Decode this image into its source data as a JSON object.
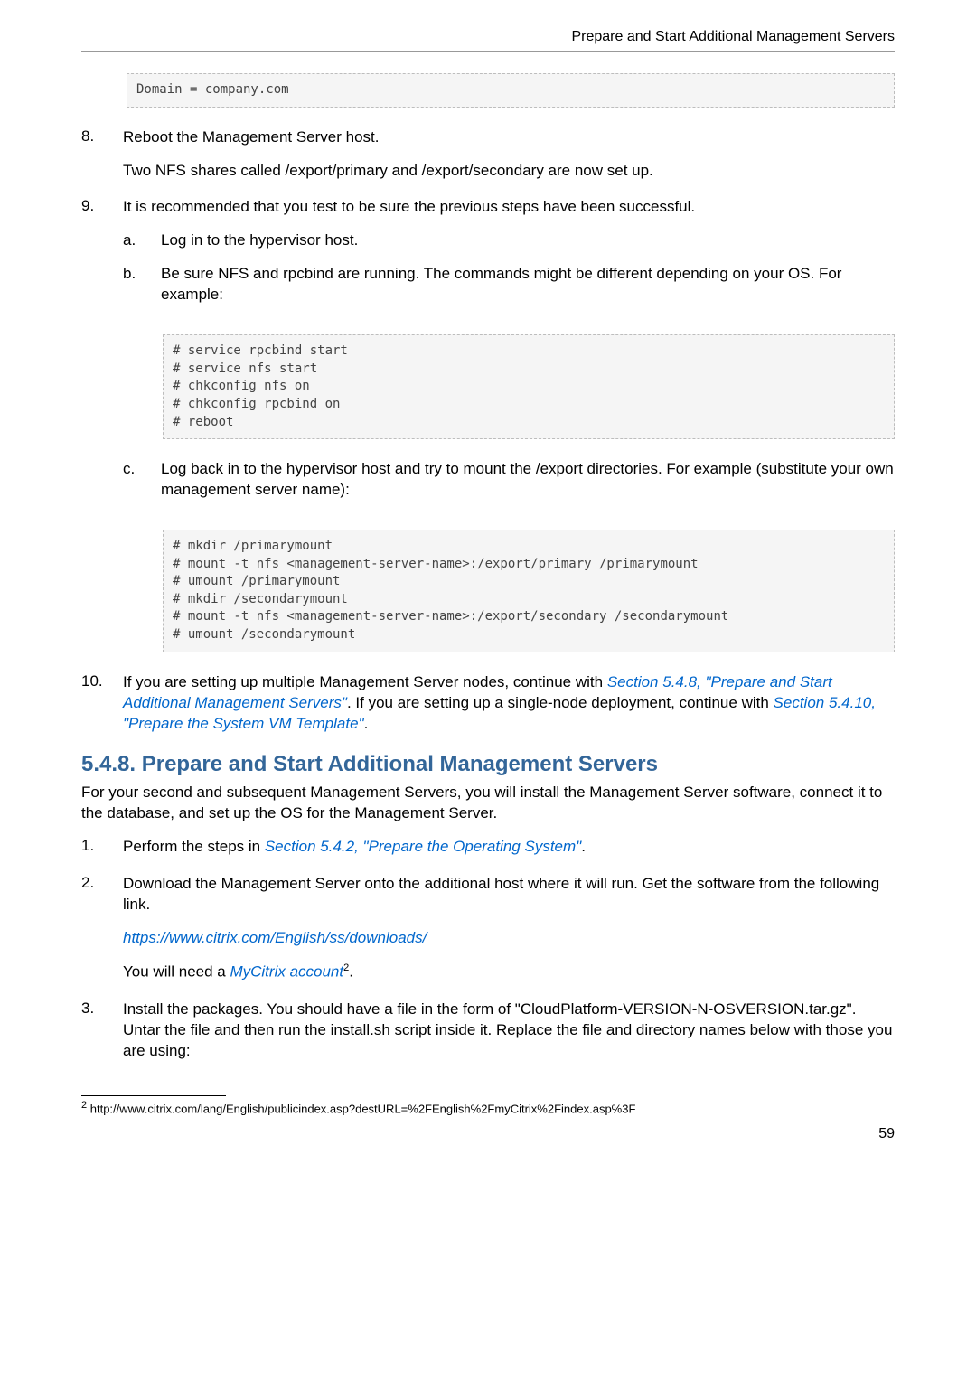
{
  "running_head": "Prepare and Start Additional Management Servers",
  "code_domain": "Domain = company.com",
  "step8": {
    "num": "8.",
    "p1": "Reboot the Management Server host.",
    "p2": "Two NFS shares called /export/primary and /export/secondary are now set up."
  },
  "step9": {
    "num": "9.",
    "p1": "It is recommended that you test to be sure the previous steps have been successful.",
    "a_num": "a.",
    "a": "Log in to the hypervisor host.",
    "b_num": "b.",
    "b": "Be sure NFS and rpcbind are running. The commands might be different depending on your OS. For example:",
    "code_b": "# service rpcbind start\n# service nfs start\n# chkconfig nfs on\n# chkconfig rpcbind on\n# reboot",
    "c_num": "c.",
    "c": "Log back in to the hypervisor host and try to mount the /export directories. For example (substitute your own management server name):",
    "code_c": "# mkdir /primarymount\n# mount -t nfs <management-server-name>:/export/primary /primarymount\n# umount /primarymount\n# mkdir /secondarymount\n# mount -t nfs <management-server-name>:/export/secondary /secondarymount\n# umount /secondarymount"
  },
  "step10": {
    "num": "10.",
    "pre": "If you are setting up multiple Management Server nodes, continue with ",
    "xref1": "Section 5.4.8, \"Prepare and Start Additional Management Servers\"",
    "mid": ". If you are setting up a single-node deployment, continue with ",
    "xref2": "Section 5.4.10, \"Prepare the System VM Template\"",
    "post": "."
  },
  "section": {
    "title": "5.4.8. Prepare and Start Additional Management Servers",
    "intro": "For your second and subsequent Management Servers, you will install the Management Server software, connect it to the database, and set up the OS for the Management Server."
  },
  "s1": {
    "num": "1.",
    "pre": "Perform the steps in ",
    "xref": "Section 5.4.2, \"Prepare the Operating System\"",
    "post": "."
  },
  "s2": {
    "num": "2.",
    "p1": "Download the Management Server onto the additional host where it will run. Get the software from the following link.",
    "link": "https://www.citrix.com/English/ss/downloads/",
    "p2_pre": "You will need a ",
    "p2_link": "MyCitrix account",
    "p2_sup": "2",
    "p2_post": "."
  },
  "s3": {
    "num": "3.",
    "p1": "Install the packages. You should have a file in the form of \"CloudPlatform-VERSION-N-OSVERSION.tar.gz\". Untar the file and then run the install.sh script inside it. Replace the file and directory names below with those you are using:"
  },
  "footnote": {
    "marker": "2",
    "text": " http://www.citrix.com/lang/English/publicindex.asp?destURL=%2FEnglish%2FmyCitrix%2Findex.asp%3F"
  },
  "page_number": "59"
}
